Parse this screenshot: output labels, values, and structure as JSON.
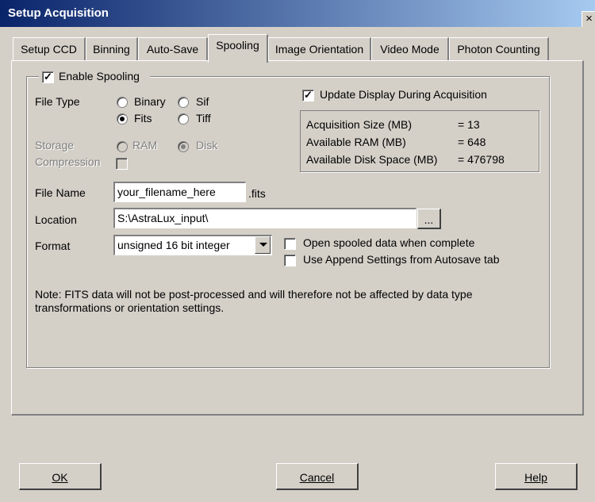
{
  "window": {
    "title": "Setup Acquisition",
    "close": "×"
  },
  "tabs": [
    {
      "label": "Setup CCD"
    },
    {
      "label": "Binning"
    },
    {
      "label": "Auto-Save"
    },
    {
      "label": "Spooling"
    },
    {
      "label": "Image Orientation"
    },
    {
      "label": "Video Mode"
    },
    {
      "label": "Photon Counting"
    }
  ],
  "spooling": {
    "enable_label": "Enable Spooling",
    "enable_checked": true,
    "file_type_label": "File Type",
    "file_types": [
      {
        "label": "Binary",
        "selected": false
      },
      {
        "label": "Sif",
        "selected": false
      },
      {
        "label": "Fits",
        "selected": true
      },
      {
        "label": "Tiff",
        "selected": false
      }
    ],
    "storage_label": "Storage",
    "storage_options": [
      {
        "label": "RAM",
        "selected": false
      },
      {
        "label": "Disk",
        "selected": true
      }
    ],
    "compression_label": "Compression",
    "update_display_label": "Update Display During Acquisition",
    "update_display_checked": true,
    "info": [
      {
        "label": "Acquisition Size (MB)",
        "value": "= 13"
      },
      {
        "label": "Available RAM (MB)",
        "value": "= 648"
      },
      {
        "label": "Available Disk Space (MB)",
        "value": "= 476798"
      }
    ],
    "file_name_label": "File Name",
    "file_name_value": "your_filename_here",
    "file_ext": ".fits",
    "location_label": "Location",
    "location_value": "S:\\AstraLux_input\\",
    "browse_label": "...",
    "format_label": "Format",
    "format_value": "unsigned 16 bit integer",
    "open_spooled_label": "Open spooled data when complete",
    "append_label": "Use Append Settings from Autosave tab",
    "note": "Note: FITS data will not be post-processed and will therefore not be affected by data type transformations or orientation settings."
  },
  "buttons": {
    "ok": "OK",
    "cancel": "Cancel",
    "help": "Help"
  }
}
